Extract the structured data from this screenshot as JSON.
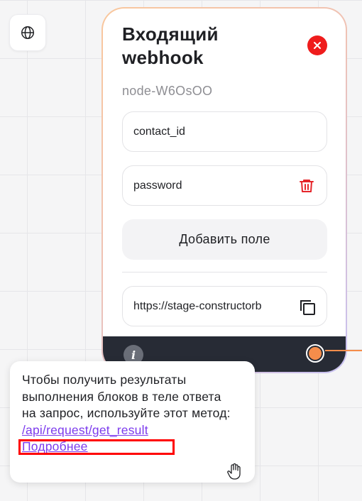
{
  "toolbar": {
    "globe_icon": "globe-icon"
  },
  "node": {
    "title": "Входящий webhook",
    "id": "node-W6OsOO",
    "close_icon": "close-icon",
    "fields": [
      {
        "value": "contact_id"
      },
      {
        "value": "password",
        "action_icon": "trash-icon"
      }
    ],
    "add_field_label": "Добавить поле",
    "url": "https://stage-constructorb",
    "copy_icon": "copy-icon",
    "info_icon": "info-icon",
    "info_label": "i"
  },
  "tooltip": {
    "text": "Чтобы получить результаты выполнения блоков в теле ответа на запрос, используйте этот метод:",
    "method_link": "/api/request/get_result",
    "more_link": "Подробнее"
  },
  "colors": {
    "accent_orange": "#f58d4b",
    "danger_red": "#ef1c1c",
    "link_purple": "#7c3aed",
    "footer_dark": "#272b35"
  }
}
